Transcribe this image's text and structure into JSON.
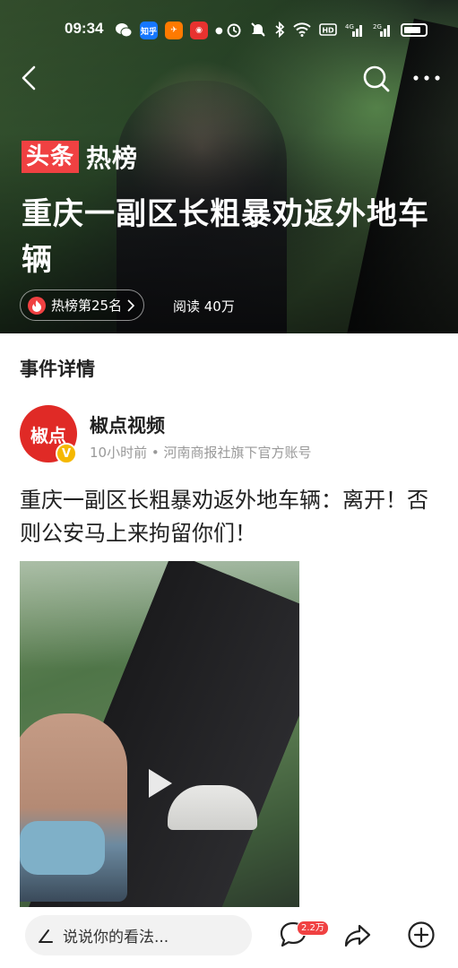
{
  "status_bar": {
    "time": "09:34",
    "app_icon_labels": [
      "知乎"
    ]
  },
  "hero": {
    "badge_brand": "头条",
    "badge_text": "热榜",
    "title": "重庆一副区长粗暴劝返外地车辆",
    "rank_label": "热榜第25名",
    "reads_label": "阅读 40万"
  },
  "section_title": "事件详情",
  "author": {
    "avatar_text": "椒点",
    "verified_mark": "V",
    "name": "椒点视频",
    "meta": "10小时前 • 河南商报社旗下官方账号"
  },
  "article": {
    "title": "重庆一副区长粗暴劝返外地车辆：离开！否则公安马上来拘留你们！"
  },
  "bottom_bar": {
    "comment_placeholder": "说说你的看法...",
    "comment_count": "2.2万"
  },
  "colors": {
    "brand_red": "#f04142",
    "avatar_red": "#e02a26",
    "verified_yellow": "#f5b800"
  }
}
